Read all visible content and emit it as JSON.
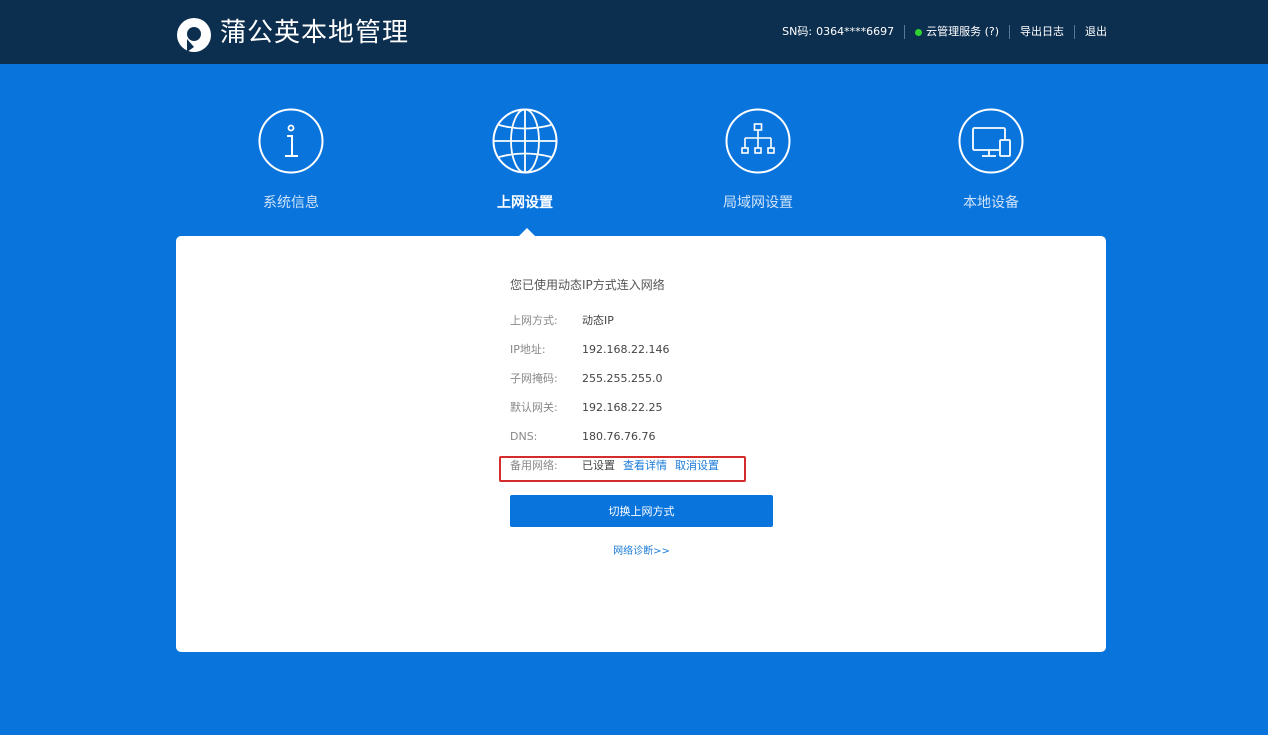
{
  "app": {
    "title": "蒲公英本地管理"
  },
  "header": {
    "sn_label": "SN码:",
    "sn_value": "0364****6697",
    "cloud_service": "云管理服务 (?)",
    "export_log": "导出日志",
    "logout": "退出",
    "status_color": "#2fd02f"
  },
  "nav": {
    "items": [
      {
        "label": "系统信息",
        "icon": "info-icon"
      },
      {
        "label": "上网设置",
        "icon": "globe-icon"
      },
      {
        "label": "局域网设置",
        "icon": "network-tree-icon"
      },
      {
        "label": "本地设备",
        "icon": "devices-icon"
      }
    ],
    "active_index": 1
  },
  "main": {
    "heading": "您已使用动态IP方式连入网络",
    "rows": [
      {
        "label": "上网方式:",
        "value": "动态IP"
      },
      {
        "label": "IP地址:",
        "value": "192.168.22.146"
      },
      {
        "label": "子网掩码:",
        "value": "255.255.255.0"
      },
      {
        "label": "默认网关:",
        "value": "192.168.22.25"
      },
      {
        "label": "DNS:",
        "value": "180.76.76.76"
      }
    ],
    "backup": {
      "label": "备用网络:",
      "value": "已设置",
      "view_details": "查看详情",
      "cancel_setting": "取消设置"
    },
    "switch_button": "切换上网方式",
    "diagnose_link": "网络诊断>>"
  },
  "colors": {
    "background": "#0a74dd",
    "topbar": "#0d2f4f",
    "highlight_border": "#d62b2b",
    "link": "#1a7bd9"
  }
}
